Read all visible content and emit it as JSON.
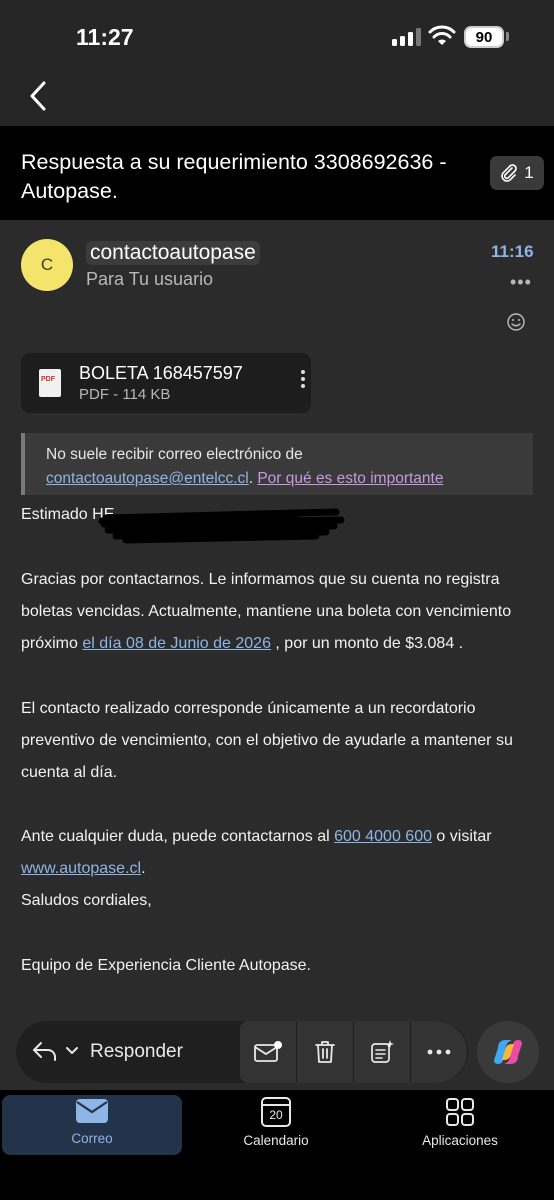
{
  "status_bar": {
    "time": "11:27",
    "battery": "90"
  },
  "email": {
    "subject": "Respuesta a su requerimiento 3308692636 -Autopase.",
    "attachment_count": "1",
    "sender": {
      "initial": "C",
      "name": "contactoautopase",
      "to": "Para Tu usuario",
      "time": "11:16"
    },
    "attachment": {
      "name": "BOLETA 168457597",
      "meta": "PDF - 114 KB",
      "icon_text": "PDF"
    },
    "warning": {
      "line1": "No suele recibir correo electrónico de",
      "email": "contactoautopase@entelcc.cl",
      "period": ".",
      "link": "Por qué es esto importante"
    },
    "body": {
      "greeting": "Estimado HE",
      "p1_l1": "Gracias por contactarnos. Le informamos que su cuenta no registra",
      "p1_l2": "boletas vencidas. Actualmente, mantiene una boleta con vencimiento",
      "p1_l3_pre": "próximo ",
      "p1_l3_link": "el día 08 de Junio de 2026",
      "p1_l3_post": " , por un monto de $3.084 .",
      "p2_l1": "El contacto realizado corresponde únicamente a un recordatorio",
      "p2_l2": "preventivo de vencimiento, con el objetivo de ayudarle a mantener su",
      "p2_l3": "cuenta al día.",
      "p3_l1_pre": "Ante cualquier duda, puede contactarnos al ",
      "p3_l1_link": "600 4000 600",
      "p3_l1_post": " o visitar",
      "p3_l2_link": "www.autopase.cl",
      "p3_l2_post": ".",
      "closing": "Saludos cordiales,",
      "signature": "Equipo de Experiencia Cliente Autopase."
    }
  },
  "action_bar": {
    "reply_label": "Responder"
  },
  "tabs": [
    {
      "label": "Correo",
      "icon": "mail-icon",
      "active": true
    },
    {
      "label": "Calendario",
      "icon": "calendar-icon",
      "day": "20"
    },
    {
      "label": "Aplicaciones",
      "icon": "apps-icon"
    }
  ],
  "colors": {
    "accent": "#8fb4e6",
    "avatar": "#f4e46c",
    "link_visited": "#c899e3"
  }
}
